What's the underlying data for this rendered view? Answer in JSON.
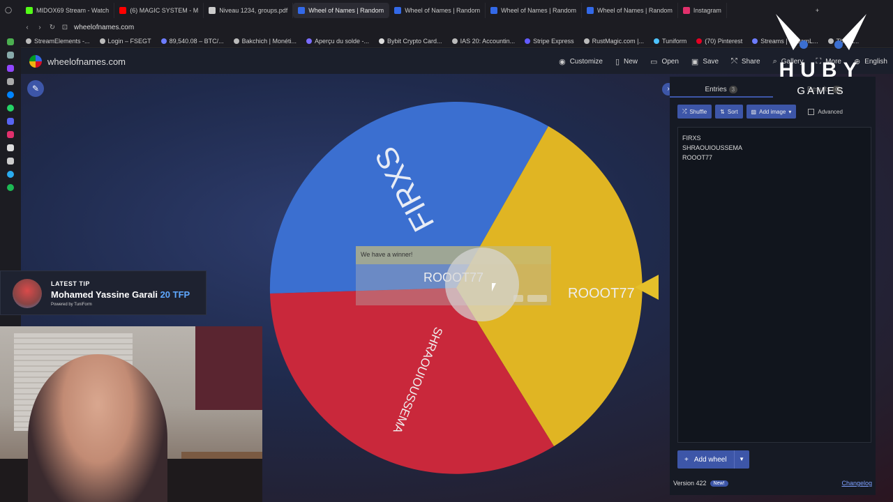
{
  "browser": {
    "tabs": [
      {
        "label": "MIDOX69 Stream - Watch",
        "color": "#53fc18"
      },
      {
        "label": "(6) MAGIC SYSTEM - M",
        "color": "#ff0000"
      },
      {
        "label": "Niveau 1234, groups.pdf",
        "color": "#cccccc"
      },
      {
        "label": "Wheel of Names | Random",
        "color": "#3369e8"
      },
      {
        "label": "Wheel of Names | Random",
        "color": "#3369e8"
      },
      {
        "label": "Wheel of Names | Random",
        "color": "#3369e8"
      },
      {
        "label": "Wheel of Names | Random",
        "color": "#3369e8"
      },
      {
        "label": "Instagram",
        "color": "#e1306c"
      }
    ],
    "active_tab_index": 3,
    "url": "wheelofnames.com",
    "bookmarks": [
      {
        "label": "StreamElements -...",
        "color": "#bbbbbb"
      },
      {
        "label": "Login – FSEGT",
        "color": "#bbbbbb"
      },
      {
        "label": "89,540.08 – BTC/...",
        "color": "#6d7cff"
      },
      {
        "label": "Bakchich | Monéti...",
        "color": "#bbbbbb"
      },
      {
        "label": "Aperçu du solde -...",
        "color": "#7a6cff"
      },
      {
        "label": "Bybit Crypto Card...",
        "color": "#dddddd"
      },
      {
        "label": "IAS 20: Accountin...",
        "color": "#bbbbbb"
      },
      {
        "label": "Stripe Express",
        "color": "#635bff"
      },
      {
        "label": "RustMagic.com |...",
        "color": "#bbbbbb"
      },
      {
        "label": "Tuniform",
        "color": "#4dc3ff"
      },
      {
        "label": "(70) Pinterest",
        "color": "#e60023"
      },
      {
        "label": "Streams | StreamL...",
        "color": "#6d7cff"
      },
      {
        "label": "The la...",
        "color": "#bbbbbb"
      }
    ]
  },
  "app": {
    "site_name": "wheelofnames.com",
    "menu": [
      {
        "label": "Customize",
        "icon": "palette-icon",
        "glyph": "◉"
      },
      {
        "label": "New",
        "icon": "file-icon",
        "glyph": "▯"
      },
      {
        "label": "Open",
        "icon": "folder-icon",
        "glyph": "▭"
      },
      {
        "label": "Save",
        "icon": "save-icon",
        "glyph": "▣"
      },
      {
        "label": "Share",
        "icon": "share-icon",
        "glyph": "⤲"
      },
      {
        "label": "Gallery",
        "icon": "search-icon",
        "glyph": "⌕"
      },
      {
        "label": "More",
        "icon": "fullscreen-icon",
        "glyph": "⛶"
      },
      {
        "label": "English",
        "icon": "globe-icon",
        "glyph": "⊕"
      }
    ],
    "wheel": {
      "segments": [
        {
          "label": "FIRXS",
          "color": "#3b6fd0"
        },
        {
          "label": "ROOOT77",
          "color": "#e0b523"
        },
        {
          "label": "SHRAOUIOUSSEMA",
          "color": "#c9283b"
        }
      ]
    },
    "winner_dialog": {
      "heading": "We have a winner!",
      "name": "ROOOT77"
    },
    "panel": {
      "tab_entries": "Entries",
      "tab_entries_count": "3",
      "tab_results": "Results",
      "tab_results_count": "0",
      "shuffle": "Shuffle",
      "sort": "Sort",
      "add_image": "Add image",
      "advanced": "Advanced",
      "entries": [
        "FIRXS",
        "SHRAOUIOUSSEMA",
        "ROOOT77"
      ],
      "add_wheel": "Add wheel",
      "version": "Version 422",
      "new_badge": "New!",
      "changelog": "Changelog"
    }
  },
  "overlay": {
    "tip_title": "LATEST TIP",
    "tip_name": "Mohamed Yassine Garali",
    "tip_amount": "20 TFP",
    "tip_powered": "Powered by TuniForm",
    "brand_main": "HUBY",
    "brand_sub": "GAMES"
  }
}
